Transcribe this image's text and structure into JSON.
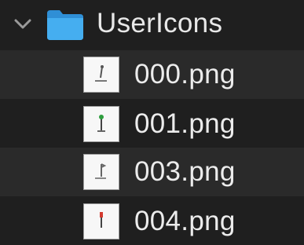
{
  "folder": {
    "name": "UserIcons",
    "expanded": true,
    "folder_color": "#3aa0e8"
  },
  "files": [
    {
      "name": "000.png",
      "icon": "tile-000-icon",
      "accent": "#555555"
    },
    {
      "name": "001.png",
      "icon": "tile-001-icon",
      "accent": "#2e9e3e"
    },
    {
      "name": "003.png",
      "icon": "tile-003-icon",
      "accent": "#666666"
    },
    {
      "name": "004.png",
      "icon": "tile-004-icon",
      "accent": "#d33a2f"
    }
  ]
}
